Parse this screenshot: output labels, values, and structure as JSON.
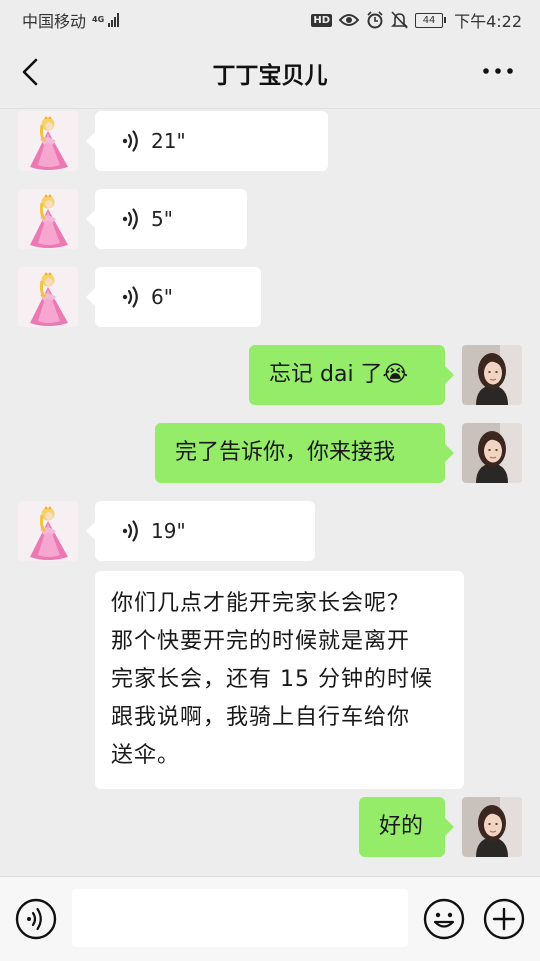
{
  "status_bar": {
    "carrier": "中国移动",
    "network": "4G",
    "hd": "HD",
    "battery": "44",
    "time": "下午4:22"
  },
  "header": {
    "title": "丁丁宝贝儿"
  },
  "messages": [
    {
      "side": "in",
      "type": "voice",
      "duration": "21\""
    },
    {
      "side": "in",
      "type": "voice",
      "duration": "5\""
    },
    {
      "side": "in",
      "type": "voice",
      "duration": "6\""
    },
    {
      "side": "out",
      "type": "text",
      "text": "忘记 dai  了😭"
    },
    {
      "side": "out",
      "type": "text",
      "text": "完了告诉你，你来接我"
    },
    {
      "side": "in",
      "type": "voice",
      "duration": "19\""
    },
    {
      "side": "in",
      "type": "text",
      "lines": [
        "你们几点才能开完家长会呢？",
        "那个快要开完的时候就是离开",
        "完家长会，还有 15 分钟的时候",
        "跟我说啊，我骑上自行车给你",
        "送伞。"
      ]
    },
    {
      "side": "out",
      "type": "text",
      "text": "好的"
    }
  ],
  "input_bar": {
    "placeholder": ""
  },
  "colors": {
    "sent_bubble": "#95ec69",
    "received_bubble": "#ffffff",
    "background": "#ededed"
  }
}
